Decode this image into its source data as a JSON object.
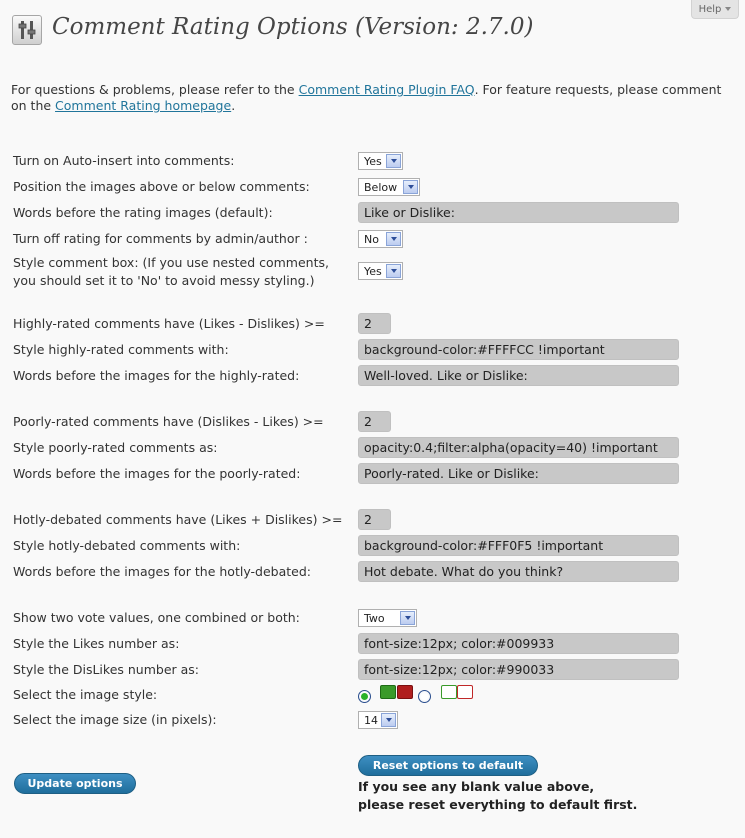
{
  "help": {
    "label": "Help"
  },
  "header": {
    "title": "Comment Rating Options (Version: 2.7.0)",
    "icon": "settings-sliders-icon"
  },
  "intro": {
    "part1": "For questions & problems, please refer to the ",
    "faq_link": "Comment Rating Plugin FAQ",
    "part2": ". For feature requests, please comment on the ",
    "home_link": "Comment Rating homepage",
    "part3": "."
  },
  "options": {
    "auto_insert": {
      "label": "Turn on Auto-insert into comments:",
      "value": "Yes"
    },
    "position": {
      "label": "Position the images above or below comments:",
      "value": "Below"
    },
    "words_default": {
      "label": "Words before the rating images (default):",
      "value": "Like or Dislike:"
    },
    "admin_off": {
      "label": "Turn off rating for comments by admin/author :",
      "value": "No"
    },
    "style_box": {
      "label_line1": "Style comment box: (If you use nested comments,",
      "label_line2": "you should set it to 'No' to avoid messy styling.)",
      "value": "Yes"
    },
    "high_threshold": {
      "label": "Highly-rated comments have (Likes - Dislikes) >=",
      "value": "2"
    },
    "high_style": {
      "label": "Style highly-rated comments with:",
      "value": "background-color:#FFFFCC !important"
    },
    "high_words": {
      "label": "Words before the images for the highly-rated:",
      "value": "Well-loved. Like or Dislike:"
    },
    "poor_threshold": {
      "label": "Poorly-rated comments have (Dislikes - Likes) >=",
      "value": "2"
    },
    "poor_style": {
      "label": "Style poorly-rated comments as:",
      "value": "opacity:0.4;filter:alpha(opacity=40) !important"
    },
    "poor_words": {
      "label": "Words before the images for the poorly-rated:",
      "value": "Poorly-rated. Like or Dislike:"
    },
    "hot_threshold": {
      "label": "Hotly-debated comments have (Likes + Dislikes) >=",
      "value": "2"
    },
    "hot_style": {
      "label": "Style hotly-debated comments with:",
      "value": "background-color:#FFF0F5 !important"
    },
    "hot_words": {
      "label": "Words before the images for the hotly-debated:",
      "value": "Hot debate. What do you think?"
    },
    "vote_values": {
      "label": "Show two vote values, one combined or both:",
      "value": "Two"
    },
    "likes_style": {
      "label": "Style the Likes number as:",
      "value": "font-size:12px; color:#009933"
    },
    "dislikes_style": {
      "label": "Style the DisLikes number as:",
      "value": "font-size:12px; color:#990033"
    },
    "image_style": {
      "label": "Select the image style:",
      "selected": 1
    },
    "image_size": {
      "label": "Select the image size (in pixels):",
      "value": "14"
    }
  },
  "buttons": {
    "update": "Update options",
    "reset": "Reset options to default"
  },
  "reset_note": {
    "line1": "If you see any blank value above,",
    "line2": "please reset everything to default first."
  },
  "colors": {
    "link": "#21759b",
    "button": "#2a7fb2",
    "field_bg": "#c8c8c8",
    "radio_on": "#29b229"
  }
}
